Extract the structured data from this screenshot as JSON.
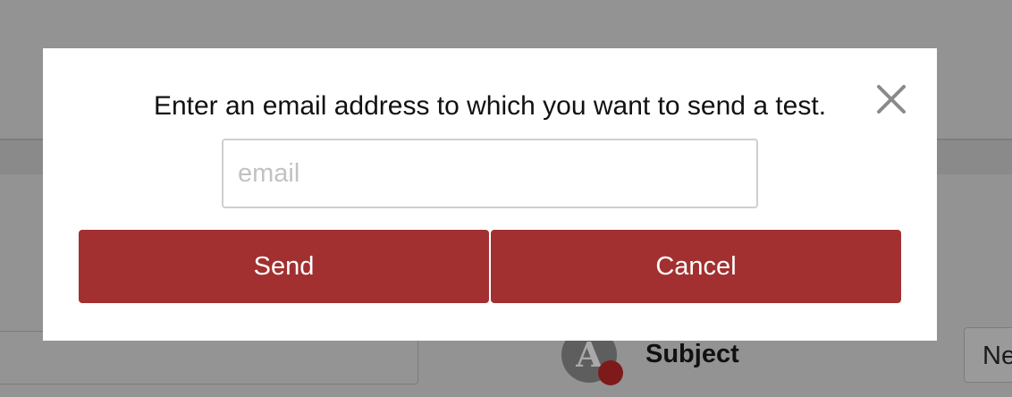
{
  "background": {
    "avatar_letter": "A",
    "subject_label": "Subject",
    "right_field_text": "Ne"
  },
  "dialog": {
    "message": "Enter an email address to which you want to send a test.",
    "close_icon": "close-icon",
    "email_placeholder": "email",
    "email_value": "",
    "send_label": "Send",
    "cancel_label": "Cancel"
  },
  "colors": {
    "overlay": "#929292",
    "button": "#a23030",
    "button_text": "#ffffff",
    "input_border": "#cfcfcf",
    "close_icon": "#8a8a8a"
  }
}
